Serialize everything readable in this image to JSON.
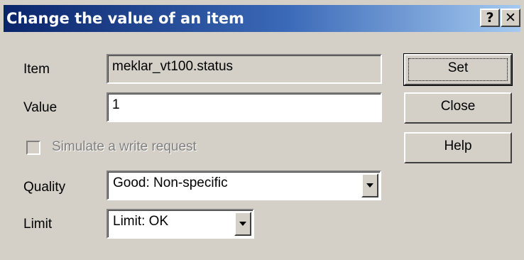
{
  "window": {
    "title": "Change the value of an item",
    "help_button": "?",
    "close_button": "✕"
  },
  "form": {
    "item_label": "Item",
    "item_value": "meklar_vt100.status",
    "value_label": "Value",
    "value_value": "1",
    "simulate_label": "Simulate a write request",
    "simulate_checked": false,
    "quality_label": "Quality",
    "quality_selected": "Good: Non-specific",
    "limit_label": "Limit",
    "limit_selected": "Limit: OK"
  },
  "buttons": {
    "set": "Set",
    "close": "Close",
    "help": "Help"
  }
}
